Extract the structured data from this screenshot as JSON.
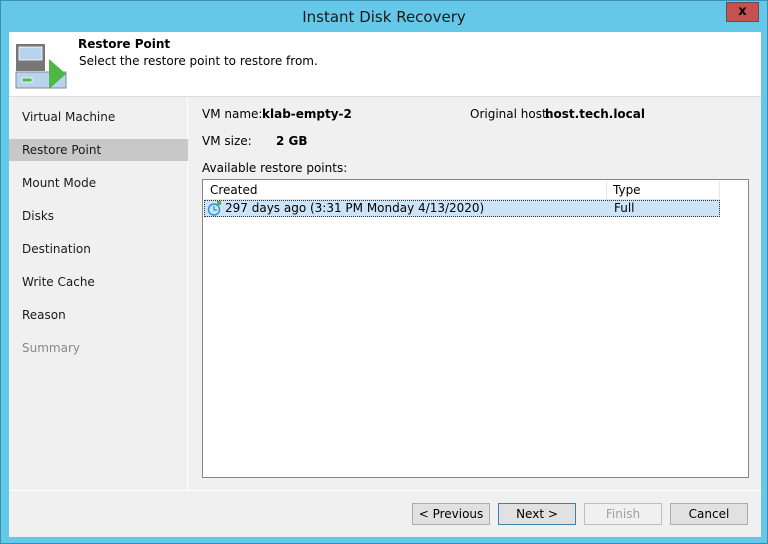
{
  "window": {
    "title": "Instant Disk Recovery",
    "close_label": "x"
  },
  "header": {
    "title": "Restore Point",
    "subtitle": "Select the restore point to restore from."
  },
  "sidebar": {
    "items": [
      {
        "label": "Virtual Machine"
      },
      {
        "label": "Restore Point"
      },
      {
        "label": "Mount Mode"
      },
      {
        "label": "Disks"
      },
      {
        "label": "Destination"
      },
      {
        "label": "Write Cache"
      },
      {
        "label": "Reason"
      },
      {
        "label": "Summary"
      }
    ]
  },
  "main": {
    "vm_name_label": "VM name:",
    "vm_name": "klab-empty-2",
    "host_label": "Original host:",
    "host": "host.tech.local",
    "vm_size_label": "VM size:",
    "vm_size": "2 GB",
    "restore_points_label": "Available restore points:",
    "columns": [
      "Created",
      "Type"
    ],
    "rows": [
      {
        "created": "297 days ago (3:31 PM Monday 4/13/2020)",
        "type": "Full"
      }
    ]
  },
  "footer": {
    "previous": "< Previous",
    "next": "Next >",
    "finish": "Finish",
    "cancel": "Cancel"
  }
}
